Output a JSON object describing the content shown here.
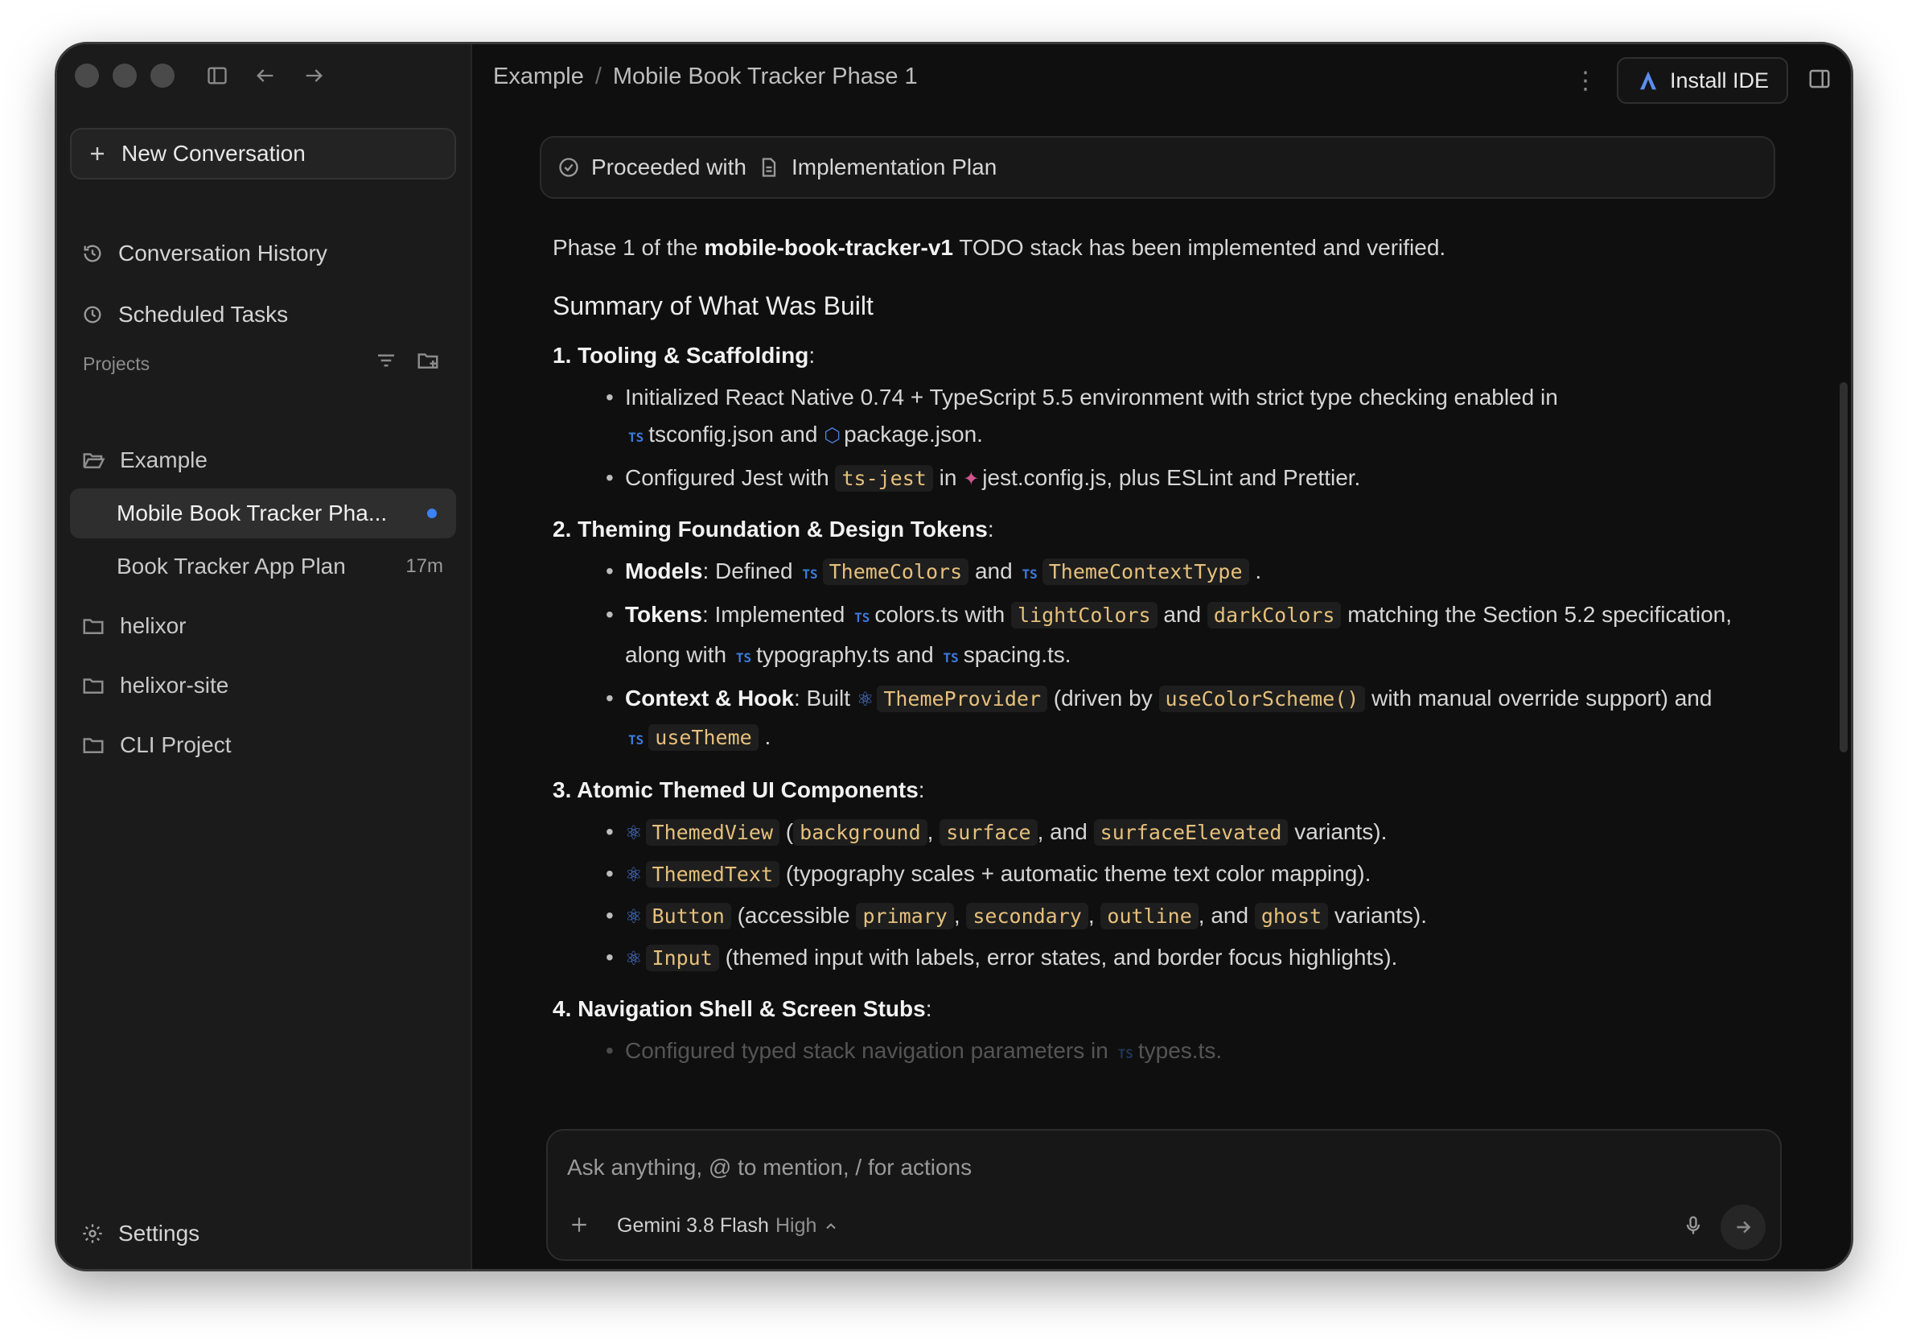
{
  "sidebar": {
    "new_conversation": "New Conversation",
    "conversation_history": "Conversation History",
    "scheduled_tasks": "Scheduled Tasks",
    "projects_label": "Projects",
    "projects": [
      {
        "name": "Example"
      },
      {
        "name": "Mobile Book Tracker Pha..."
      },
      {
        "name": "Book Tracker App Plan",
        "ago": "17m"
      },
      {
        "name": "helixor"
      },
      {
        "name": "helixor-site"
      },
      {
        "name": "CLI Project"
      }
    ],
    "settings": "Settings"
  },
  "header": {
    "crumb1": "Example",
    "sep": "/",
    "crumb2": "Mobile Book Tracker Phase 1",
    "install_ide": "Install IDE"
  },
  "proceeded": {
    "prefix": "Proceeded with",
    "doc": "Implementation Plan"
  },
  "content": {
    "intro_a": "Phase 1 of the",
    "intro_b": "mobile-book-tracker-v1",
    "intro_c": "TODO stack has been implemented and verified.",
    "summary_title": "Summary of What Was Built",
    "s1_title": "1. Tooling & Scaffolding",
    "s1_b1_a": "Initialized React Native 0.74 + TypeScript 5.5 environment with strict type checking enabled in",
    "s1_b1_f1": "tsconfig.json",
    "s1_b1_and": "and",
    "s1_b1_f2": "package.json",
    "s1_b2_a": "Configured Jest with",
    "s1_b2_code": "ts-jest",
    "s1_b2_in": "in",
    "s1_b2_f": "jest.config.js",
    "s1_b2_b": ", plus ESLint and Prettier.",
    "s2_title": "2. Theming Foundation & Design Tokens",
    "s2_b1_label": "Models",
    "s2_b1_a": ": Defined",
    "s2_b1_c1": "ThemeColors",
    "s2_b1_and": "and",
    "s2_b1_c2": "ThemeContextType",
    "s2_b2_label": "Tokens",
    "s2_b2_a": ": Implemented",
    "s2_b2_f1": "colors.ts",
    "s2_b2_with": "with",
    "s2_b2_c1": "lightColors",
    "s2_b2_and": "and",
    "s2_b2_c2": "darkColors",
    "s2_b2_b": "matching the Section 5.2 specification, along with",
    "s2_b2_f2": "typography.ts",
    "s2_b2_and2": "and",
    "s2_b2_f3": "spacing.ts",
    "s2_b3_label": "Context & Hook",
    "s2_b3_a": ": Built",
    "s2_b3_c1": "ThemeProvider",
    "s2_b3_b": "(driven by",
    "s2_b3_c2": "useColorScheme()",
    "s2_b3_c": "with manual override support) and",
    "s2_b3_c3": "useTheme",
    "s3_title": "3. Atomic Themed UI Components",
    "s3_b1_c1": "ThemedView",
    "s3_b1_c2": "background",
    "s3_b1_c3": "surface",
    "s3_b1_c4": "surfaceElevated",
    "s3_b1_tail": "variants).",
    "s3_b2_c1": "ThemedText",
    "s3_b2_tail": "(typography scales + automatic theme text color mapping).",
    "s3_b3_c1": "Button",
    "s3_b3_a": "(accessible",
    "s3_b3_c2": "primary",
    "s3_b3_c3": "secondary",
    "s3_b3_c4": "outline",
    "s3_b3_c5": "ghost",
    "s3_b3_tail": "variants).",
    "s3_b4_c1": "Input",
    "s3_b4_tail": "(themed input with labels, error states, and border focus highlights).",
    "s4_title": "4. Navigation Shell & Screen Stubs",
    "s4_b1_a": "Configured typed stack navigation parameters in",
    "s4_b1_f": "types.ts"
  },
  "composer": {
    "placeholder": "Ask anything, @ to mention, / for actions",
    "model": "Gemini 3.8 Flash",
    "level": "High"
  }
}
